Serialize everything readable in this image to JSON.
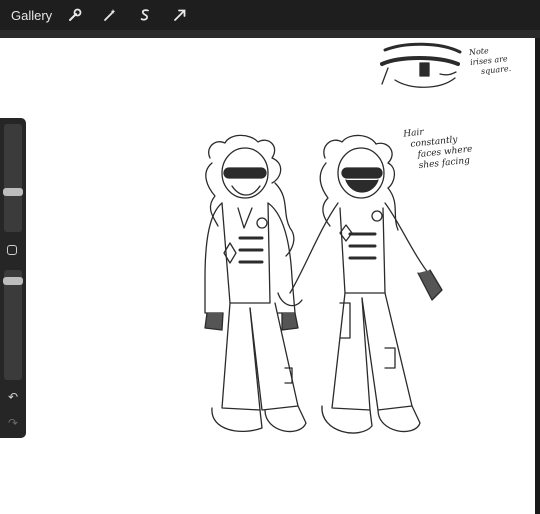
{
  "topbar": {
    "gallery_label": "Gallery",
    "tools": [
      "wrench-icon",
      "magic-wand-icon",
      "selection-s-icon",
      "transform-arrow-icon"
    ]
  },
  "sidebar": {
    "brush_size_level": 0.55,
    "opacity_level": 0.95
  },
  "annotations": {
    "note_lines": [
      "Note",
      "irises are",
      "square."
    ],
    "hair_lines": [
      "Hair",
      "constantly",
      "faces where",
      "shes facing"
    ]
  },
  "colors": {
    "toolbar_bg": "#1e1e1e",
    "canvas_bg": "#ffffff",
    "ink": "#222222"
  }
}
